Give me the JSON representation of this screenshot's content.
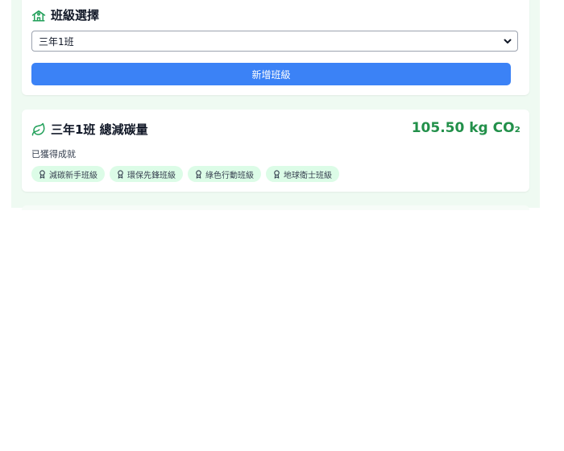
{
  "class_select": {
    "title": "班級選擇",
    "selected_class": "三年1班",
    "add_button_label": "新增班級"
  },
  "total": {
    "title": "三年1班 總減碳量",
    "value": "105.50 kg CO₂",
    "achievements_label": "已獲得成就",
    "achievements": [
      "減碳新手班級",
      "環保先鋒班級",
      "綠色行動班級",
      "地球衛士班級"
    ]
  },
  "icons": {
    "school": "school-icon",
    "leaf": "leaf-icon",
    "award": "award-icon",
    "chevron": "chevron-down-icon"
  },
  "colors": {
    "accent_green": "#22904a",
    "button_blue": "#3b82f6",
    "badge_bg": "#dcfce7",
    "page_bg": "#effaf2"
  }
}
